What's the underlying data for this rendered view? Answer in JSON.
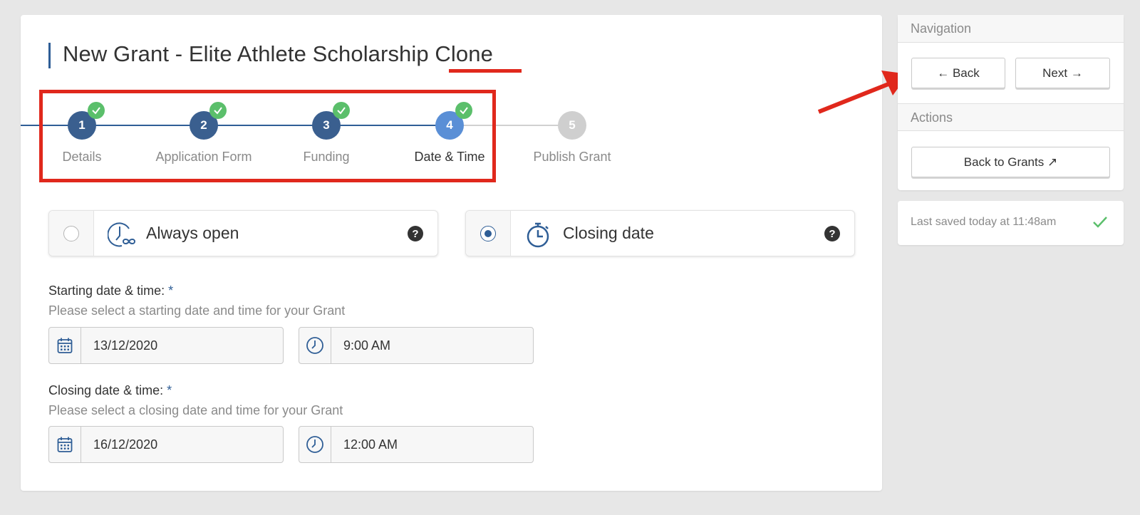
{
  "page": {
    "title": "New Grant - Elite Athlete Scholarship Clone"
  },
  "stepper": {
    "steps": [
      {
        "number": "1",
        "label": "Details",
        "completed": true
      },
      {
        "number": "2",
        "label": "Application Form",
        "completed": true
      },
      {
        "number": "3",
        "label": "Funding",
        "completed": true
      },
      {
        "number": "4",
        "label": "Date & Time",
        "completed": true,
        "active": true
      },
      {
        "number": "5",
        "label": "Publish Grant",
        "completed": false
      }
    ]
  },
  "options": {
    "always_open": {
      "label": "Always open",
      "selected": false,
      "help": "?"
    },
    "closing_date": {
      "label": "Closing date",
      "selected": true,
      "help": "?"
    }
  },
  "start": {
    "label": "Starting date & time:",
    "required_mark": "*",
    "help": "Please select a starting date and time for your Grant",
    "date": "13/12/2020",
    "time": "9:00 AM"
  },
  "closing": {
    "label": "Closing date & time:",
    "required_mark": "*",
    "help": "Please select a closing date and time for your Grant",
    "date": "16/12/2020",
    "time": "12:00 AM"
  },
  "sidebar": {
    "navigation_heading": "Navigation",
    "back_label": "← Back",
    "next_label": "Next →",
    "actions_heading": "Actions",
    "back_to_grants_label": "Back to Grants ↗",
    "last_saved": "Last saved today at 11:48am"
  },
  "colors": {
    "primary": "#2f5e96",
    "step_completed": "#3a5f8f",
    "step_active": "#5a8fd6",
    "step_pending": "#cfcfcf",
    "check_green": "#5bbf6b",
    "annotation_red": "#e0281c"
  }
}
